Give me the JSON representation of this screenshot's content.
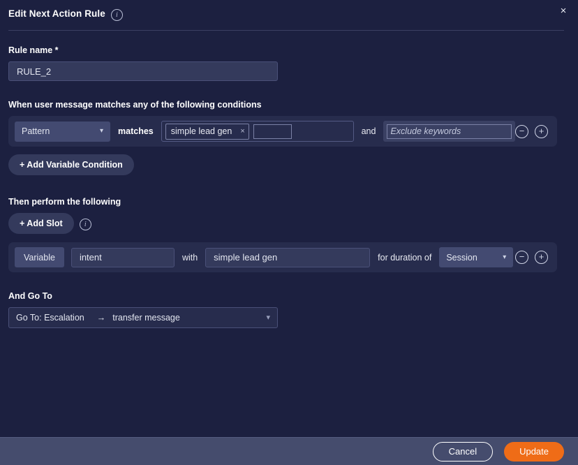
{
  "dialog": {
    "title": "Edit Next Action Rule",
    "title_info_icon": "info-icon",
    "close_icon": "×"
  },
  "rule_name": {
    "label": "Rule name *",
    "value": "RULE_2"
  },
  "conditions": {
    "label": "When user message matches any of the following conditions",
    "row": {
      "type_select": "Pattern",
      "matches_label": "matches",
      "chips": [
        {
          "text": "simple lead gen",
          "remove_icon": "×"
        }
      ],
      "chip_input_value": "",
      "and_label": "and",
      "exclude_placeholder": "Exclude keywords",
      "exclude_value": "",
      "remove_icon": "−",
      "add_icon": "+"
    },
    "add_variable_condition_label": "+ Add Variable Condition"
  },
  "actions": {
    "label": "Then perform the following",
    "add_slot_label": "+ Add Slot",
    "add_slot_info_icon": "info-icon",
    "row": {
      "kind": "Variable",
      "variable_name": "intent",
      "with_label": "with",
      "variable_value": "simple lead gen",
      "duration_label": "for duration of",
      "duration_select": "Session",
      "remove_icon": "−",
      "add_icon": "+"
    }
  },
  "goto": {
    "label": "And Go To",
    "target": "Go To: Escalation",
    "arrow": "→",
    "detail": "transfer message"
  },
  "footer": {
    "cancel_label": "Cancel",
    "update_label": "Update"
  },
  "colors": {
    "background": "#1c2040",
    "panel": "#272c4d",
    "field": "#343a5c",
    "accent": "#ef6c17",
    "footer": "#454c6d"
  }
}
